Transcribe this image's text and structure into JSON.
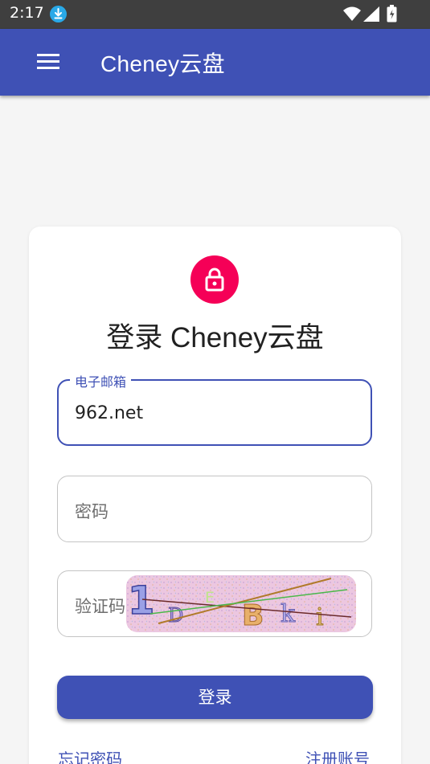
{
  "status_bar": {
    "time": "2:17"
  },
  "app_bar": {
    "title": "Cheney云盘"
  },
  "login_card": {
    "heading": "登录 Cheney云盘",
    "email": {
      "label": "电子邮箱",
      "value": "962.net"
    },
    "password": {
      "placeholder": "密码"
    },
    "captcha": {
      "placeholder": "验证码",
      "captcha_text": "1DEBki"
    },
    "login_button": "登录",
    "forgot_password": "忘记密码",
    "register": "注册账号"
  },
  "colors": {
    "primary": "#3f51b5",
    "accent": "#f50057",
    "status_bar": "#3f3f3f"
  }
}
